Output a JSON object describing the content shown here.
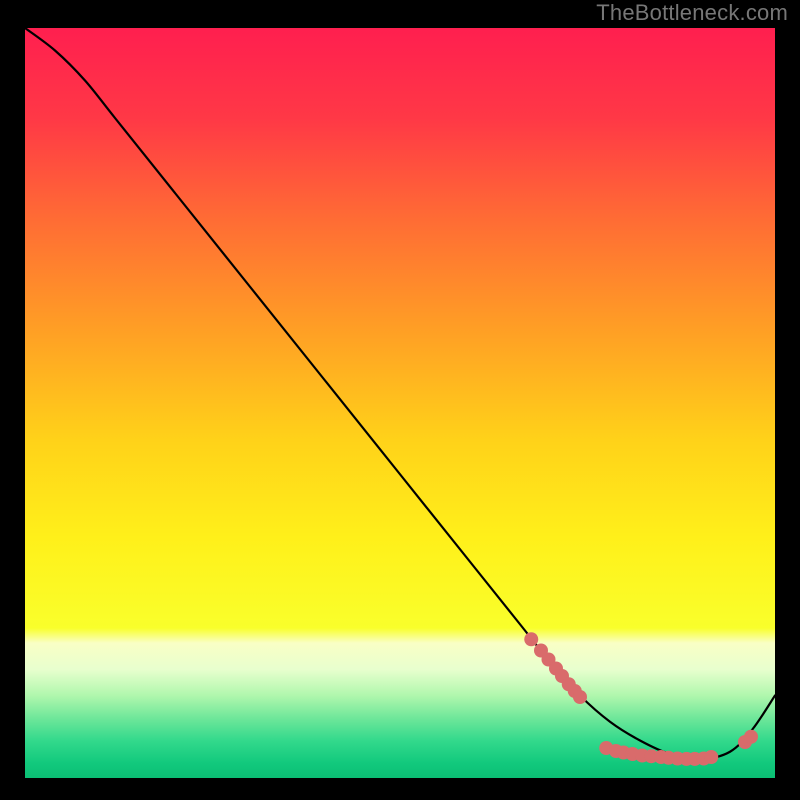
{
  "attribution": "TheBottleneck.com",
  "chart_data": {
    "type": "line",
    "title": "",
    "xlabel": "",
    "ylabel": "",
    "xlim": [
      0,
      100
    ],
    "ylim": [
      0,
      100
    ],
    "grid": false,
    "legend": false,
    "series": [
      {
        "name": "curve",
        "x": [
          0,
          4,
          8,
          12,
          20,
          30,
          40,
          50,
          60,
          66,
          70,
          74,
          78,
          82,
          86,
          90,
          94,
          97,
          100
        ],
        "y": [
          100,
          97,
          93,
          88,
          78,
          65.5,
          53,
          40.5,
          28,
          20.5,
          15.5,
          11,
          7.5,
          5,
          3.2,
          2.5,
          3.5,
          6.5,
          11
        ]
      }
    ],
    "markers": [
      {
        "name": "cluster",
        "color": "#d96b6b",
        "points": [
          {
            "x": 67.5,
            "y": 18.5
          },
          {
            "x": 68.8,
            "y": 17.0
          },
          {
            "x": 69.8,
            "y": 15.8
          },
          {
            "x": 70.8,
            "y": 14.6
          },
          {
            "x": 71.6,
            "y": 13.6
          },
          {
            "x": 72.5,
            "y": 12.5
          },
          {
            "x": 73.3,
            "y": 11.6
          },
          {
            "x": 74.0,
            "y": 10.8
          },
          {
            "x": 77.5,
            "y": 4.0
          },
          {
            "x": 78.8,
            "y": 3.6
          },
          {
            "x": 79.8,
            "y": 3.4
          },
          {
            "x": 81.0,
            "y": 3.2
          },
          {
            "x": 82.3,
            "y": 3.0
          },
          {
            "x": 83.5,
            "y": 2.9
          },
          {
            "x": 84.8,
            "y": 2.8
          },
          {
            "x": 85.8,
            "y": 2.7
          },
          {
            "x": 87.0,
            "y": 2.6
          },
          {
            "x": 88.2,
            "y": 2.55
          },
          {
            "x": 89.3,
            "y": 2.55
          },
          {
            "x": 90.5,
            "y": 2.6
          },
          {
            "x": 91.5,
            "y": 2.8
          },
          {
            "x": 96.0,
            "y": 4.8
          },
          {
            "x": 96.8,
            "y": 5.5
          }
        ]
      }
    ],
    "gradient": {
      "stops": [
        {
          "offset": 0.0,
          "color": "#ff1f4f"
        },
        {
          "offset": 0.12,
          "color": "#ff3846"
        },
        {
          "offset": 0.25,
          "color": "#ff6a35"
        },
        {
          "offset": 0.4,
          "color": "#ff9e25"
        },
        {
          "offset": 0.55,
          "color": "#ffd219"
        },
        {
          "offset": 0.68,
          "color": "#fff01a"
        },
        {
          "offset": 0.8,
          "color": "#f9ff2b"
        },
        {
          "offset": 0.82,
          "color": "#f9ffc5"
        },
        {
          "offset": 0.855,
          "color": "#e8ffce"
        },
        {
          "offset": 0.89,
          "color": "#b0f7ad"
        },
        {
          "offset": 0.92,
          "color": "#6fe79a"
        },
        {
          "offset": 0.95,
          "color": "#33d98c"
        },
        {
          "offset": 0.98,
          "color": "#12c97d"
        },
        {
          "offset": 1.0,
          "color": "#0bbf74"
        }
      ]
    }
  }
}
